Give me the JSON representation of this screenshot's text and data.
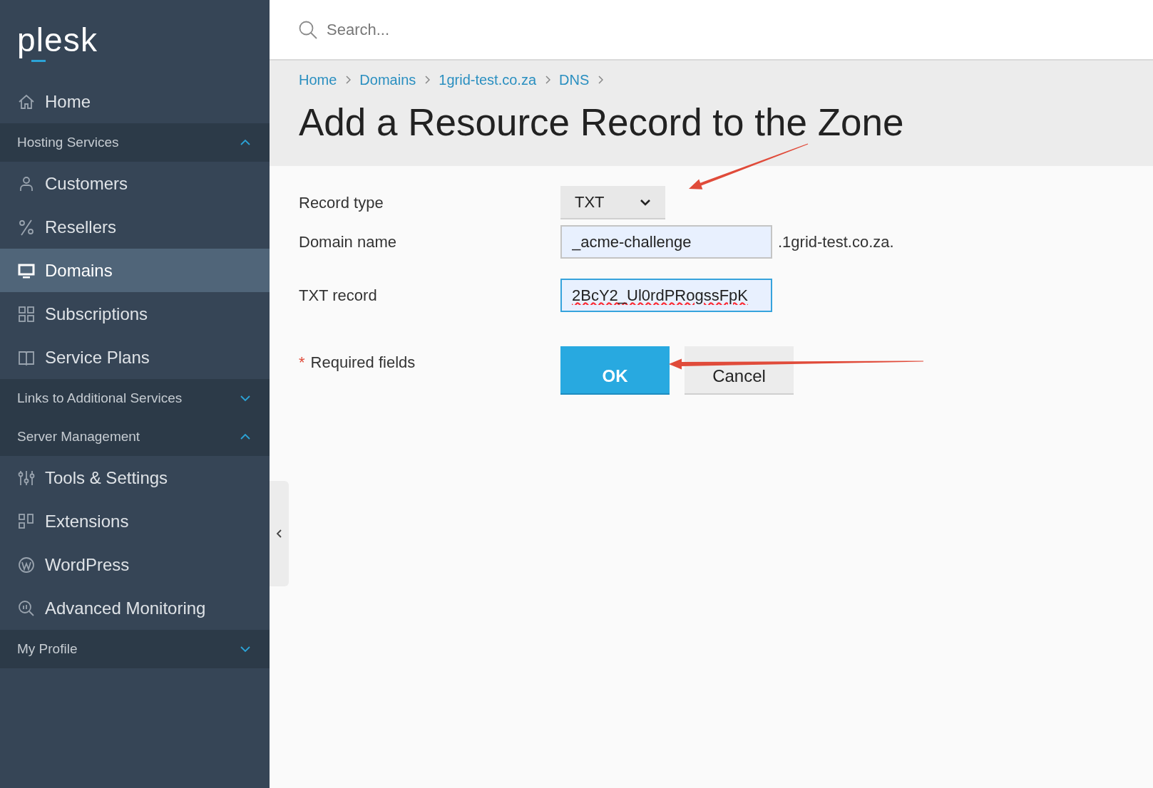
{
  "logo": {
    "text": "plesk"
  },
  "search": {
    "placeholder": "Search..."
  },
  "sidebar": {
    "home": {
      "label": "Home",
      "selected": false
    },
    "sections": [
      {
        "title": "Hosting Services",
        "expanded": true,
        "items": [
          {
            "label": "Customers",
            "selected": false
          },
          {
            "label": "Resellers",
            "selected": false
          },
          {
            "label": "Domains",
            "selected": true
          },
          {
            "label": "Subscriptions",
            "selected": false
          },
          {
            "label": "Service Plans",
            "selected": false
          }
        ]
      },
      {
        "title": "Links to Additional Services",
        "expanded": false
      },
      {
        "title": "Server Management",
        "expanded": true,
        "items": [
          {
            "label": "Tools & Settings",
            "selected": false
          },
          {
            "label": "Extensions",
            "selected": false
          },
          {
            "label": "WordPress",
            "selected": false
          },
          {
            "label": "Advanced Monitoring",
            "selected": false
          }
        ]
      },
      {
        "title": "My Profile",
        "expanded": false
      }
    ]
  },
  "breadcrumbs": [
    "Home",
    "Domains",
    "1grid-test.co.za",
    "DNS"
  ],
  "title": "Add a Resource Record to the Zone",
  "form": {
    "fields": [
      {
        "kind": "select",
        "label": "Record type",
        "value": "TXT"
      },
      {
        "kind": "input",
        "label": "Domain name",
        "value": "_acme-challenge",
        "suffix": ".1grid-test.co.za.",
        "focused": false,
        "spellcheck_error": false
      },
      {
        "kind": "input",
        "label": "TXT record",
        "value": "2BcY2_Ul0rdPRogssFpK",
        "focused": true,
        "spellcheck_error": true
      }
    ],
    "required_note": {
      "mark": "*",
      "text": "Required fields"
    },
    "buttons": [
      {
        "label": "OK",
        "kind": "primary"
      },
      {
        "label": "Cancel",
        "kind": "secondary"
      }
    ]
  }
}
